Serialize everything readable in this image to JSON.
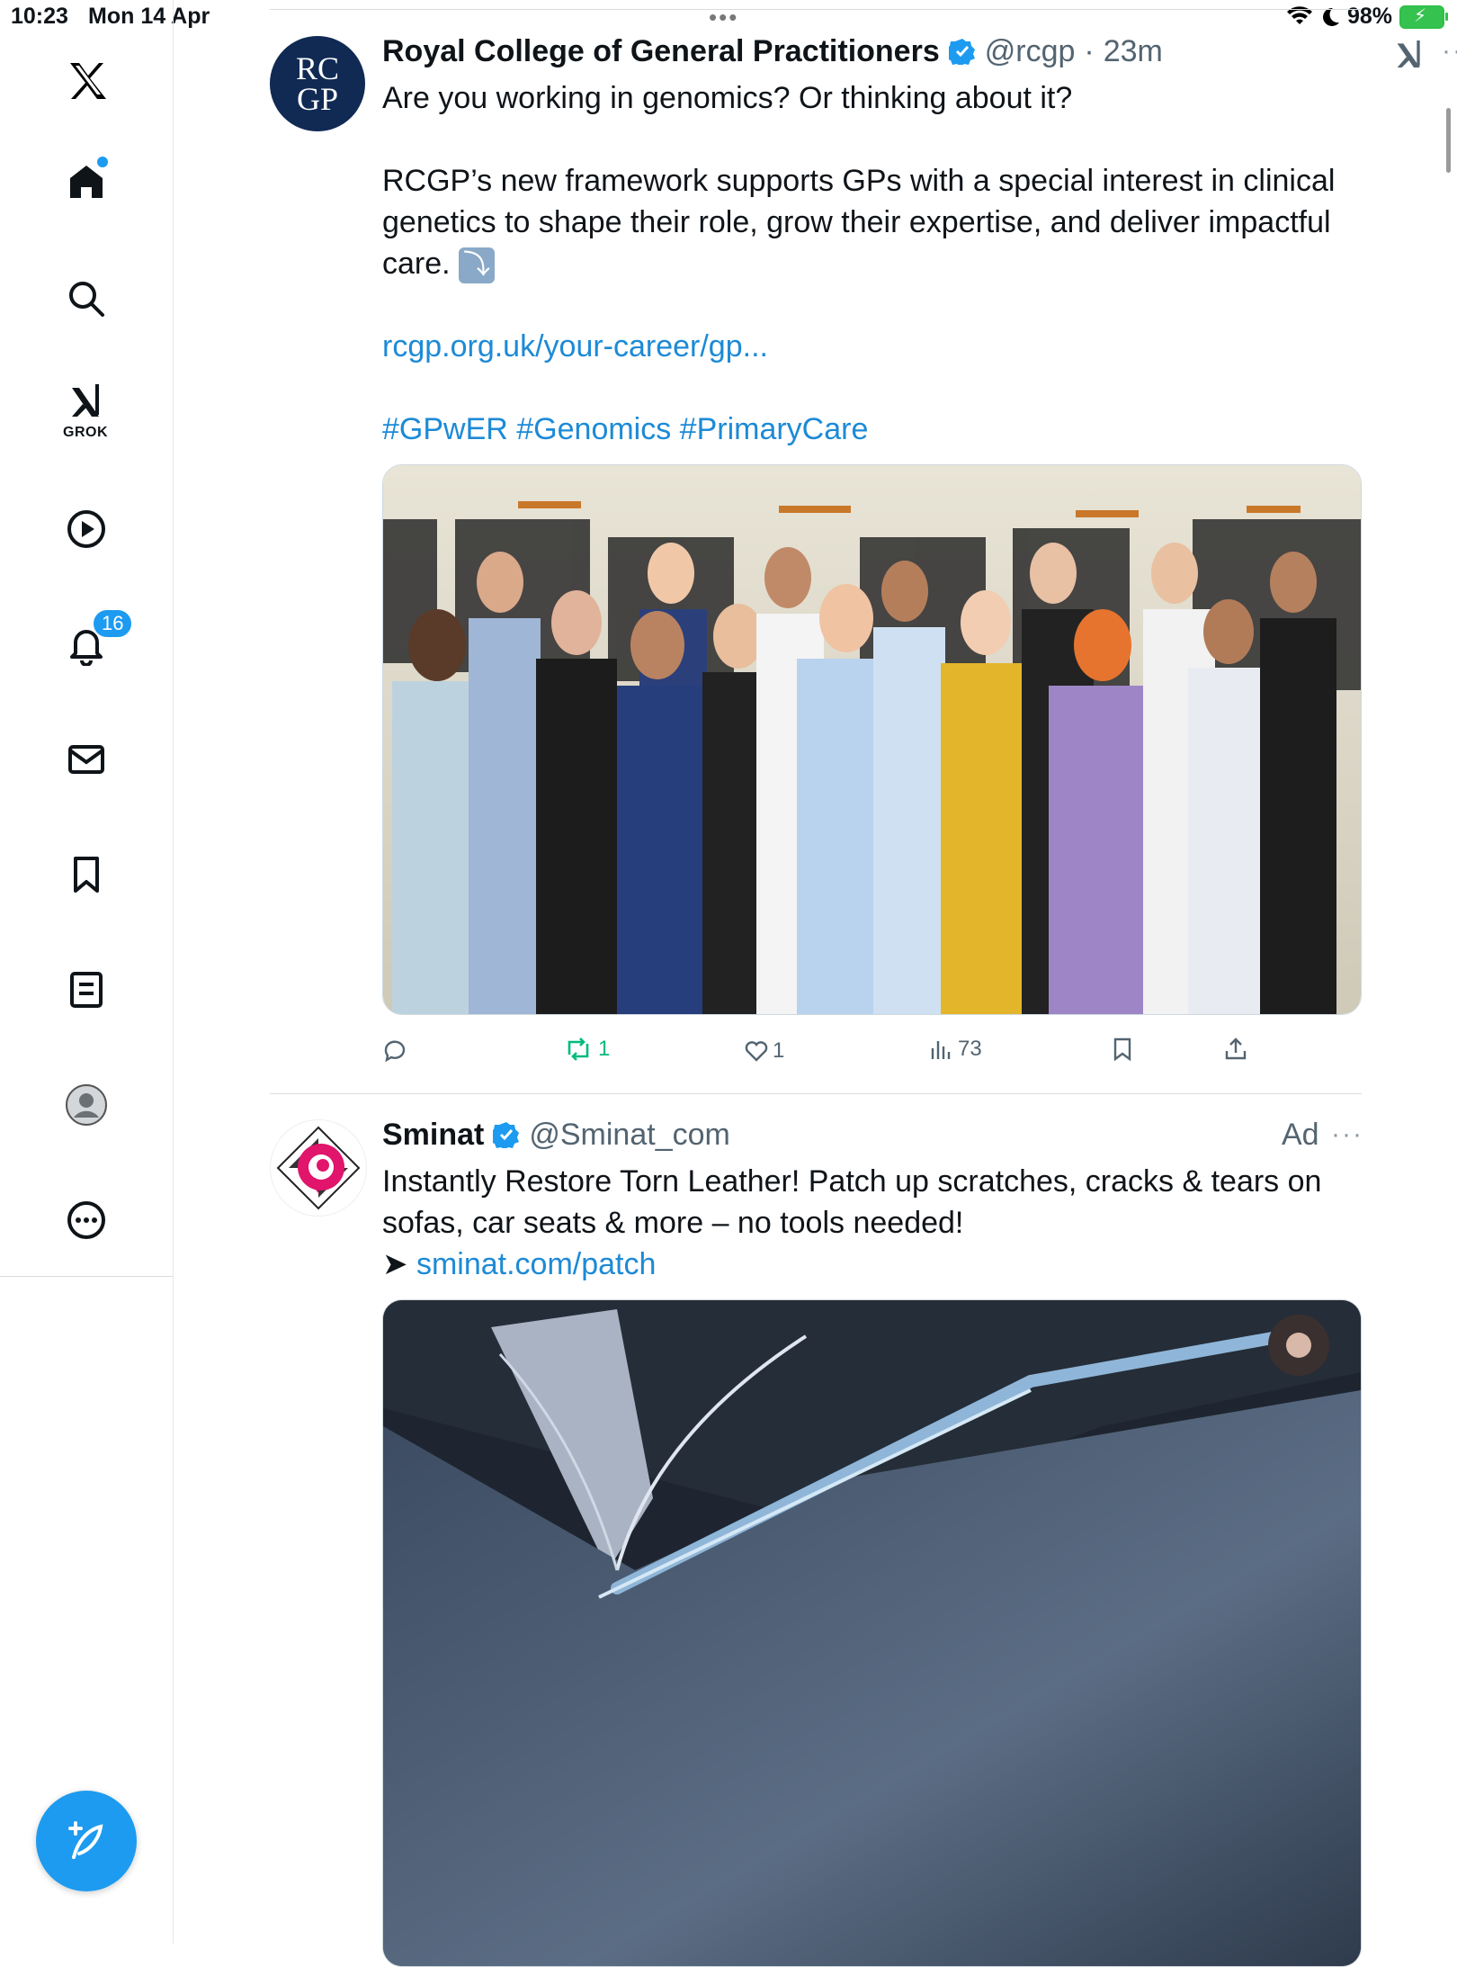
{
  "status_bar": {
    "time": "10:23",
    "date": "Mon 14 Apr",
    "battery": "98%"
  },
  "sidebar": {
    "notifications_count": "16",
    "grok_label": "GROK"
  },
  "tweets": [
    {
      "name": "Royal College of General Practitioners",
      "handle": "@rcgp",
      "time": "23m",
      "avatar_text": [
        "RC",
        "GP"
      ],
      "text": "Are you working in genomics? Or thinking about it?\n\nRCGP’s new framework supports GPs with a special interest in clinical genetics to shape their role, grow their expertise, and deliver impactful care.",
      "emoji": "⤵️",
      "link": "rcgp.org.uk/your-career/gp...",
      "hashtags": "#GPwER #Genomics #PrimaryCare",
      "media_alt": "Group photo of GPs standing outdoors",
      "actions": {
        "replies": "",
        "retweets": "1",
        "likes": "1",
        "views": "73"
      }
    },
    {
      "name": "Sminat",
      "handle": "@Sminat_com",
      "ad_label": "Ad",
      "text": "Instantly Restore Torn Leather! Patch up scratches, cracks & tears on sofas, car seats & more – no tools needed!",
      "link_prefix": "➤",
      "link": "sminat.com/patch",
      "media_alt": "Close-up of torn leather being repaired"
    }
  ],
  "colors": {
    "accent": "#1d9bf0",
    "link": "#1d8ad6",
    "retweet_green": "#00ba7c",
    "muted": "#536471"
  }
}
